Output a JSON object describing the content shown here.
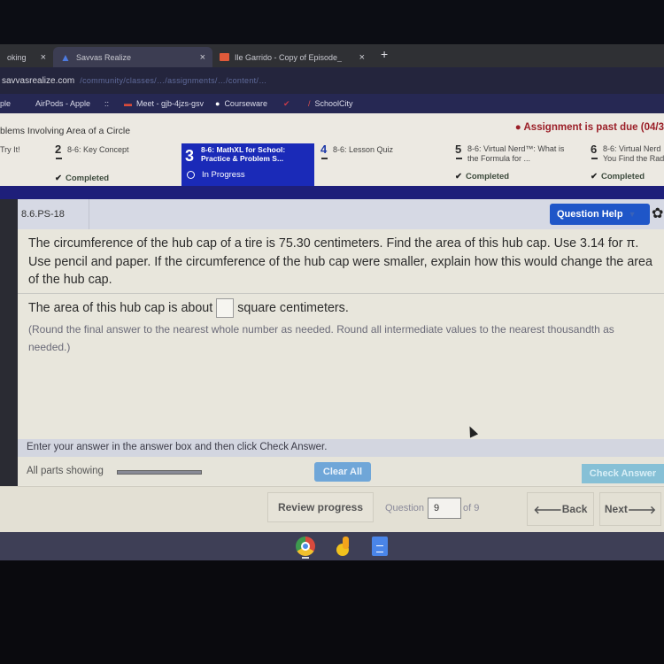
{
  "browser": {
    "tabs": [
      {
        "title": "oking",
        "active": false
      },
      {
        "title": "Savvas Realize",
        "active": true
      },
      {
        "title": "Ile Garrido - Copy of Episode_",
        "active": false
      }
    ],
    "close_glyph": "×",
    "new_tab_glyph": "+",
    "url_domain": "savvasrealize.com",
    "url_path": "/community/classes/…/assignments/…/content/…",
    "bookmarks": [
      {
        "label": "ple"
      },
      {
        "label": "AirPods - Apple"
      },
      {
        "label": "::"
      },
      {
        "label": "Meet - gjb-4jzs-gsv"
      },
      {
        "label": "Courseware"
      },
      {
        "label": ""
      },
      {
        "label": "SchoolCity"
      }
    ]
  },
  "assignment": {
    "title": "blems Involving Area of a Circle",
    "past_due": "Assignment is past due (04/3",
    "steps": [
      {
        "num": "",
        "label": "Try It!",
        "status": ""
      },
      {
        "num": "2",
        "label": "8-6: Key Concept",
        "status": "Completed"
      },
      {
        "num": "3",
        "label": "8-6: MathXL for School: Practice & Problem S...",
        "label_line1": "8-6: MathXL for School:",
        "label_line2": "Practice & Problem S...",
        "status": "In Progress"
      },
      {
        "num": "4",
        "label": "8-6: Lesson Quiz",
        "status": ""
      },
      {
        "num": "5",
        "label_line1": "8-6: Virtual Nerd™: What is",
        "label_line2": "the Formula for ...",
        "status": "Completed"
      },
      {
        "num": "6",
        "label_line1": "8-6: Virtual Nerd",
        "label_line2": "You Find the Rad",
        "status": "Completed"
      }
    ]
  },
  "question": {
    "id": "8.6.PS-18",
    "help_label": "Question Help",
    "text": "The circumference of the hub cap of a tire is 75.30 centimeters. Find the area of this hub cap. Use 3.14 for π. Use pencil and paper. If the circumference of the hub cap were smaller, explain how this would change the area of the hub cap.",
    "answer_prefix": "The area of this hub cap is about",
    "answer_value": "",
    "answer_suffix": "square centimeters.",
    "hint": "(Round the final answer to the nearest whole number as needed.  Round all intermediate values to the nearest thousandth as needed.)",
    "instruction": "Enter your answer in the answer box and then click Check Answer.",
    "parts_label": "All parts showing",
    "clear_label": "Clear All",
    "check_label": "Check Answer"
  },
  "nav": {
    "review_label": "Review progress",
    "question_label": "Question",
    "question_current": "9",
    "question_total": "of 9",
    "back_label": "Back",
    "next_label": "Next"
  },
  "shelf": {
    "apps": [
      "Chrome",
      "Mote",
      "Google Docs"
    ]
  },
  "colors": {
    "accent_blue": "#1f56c8",
    "active_step": "#1a2ab8",
    "past_due_red": "#9b1f28",
    "check_answer_disabled": "#86c0d6"
  }
}
